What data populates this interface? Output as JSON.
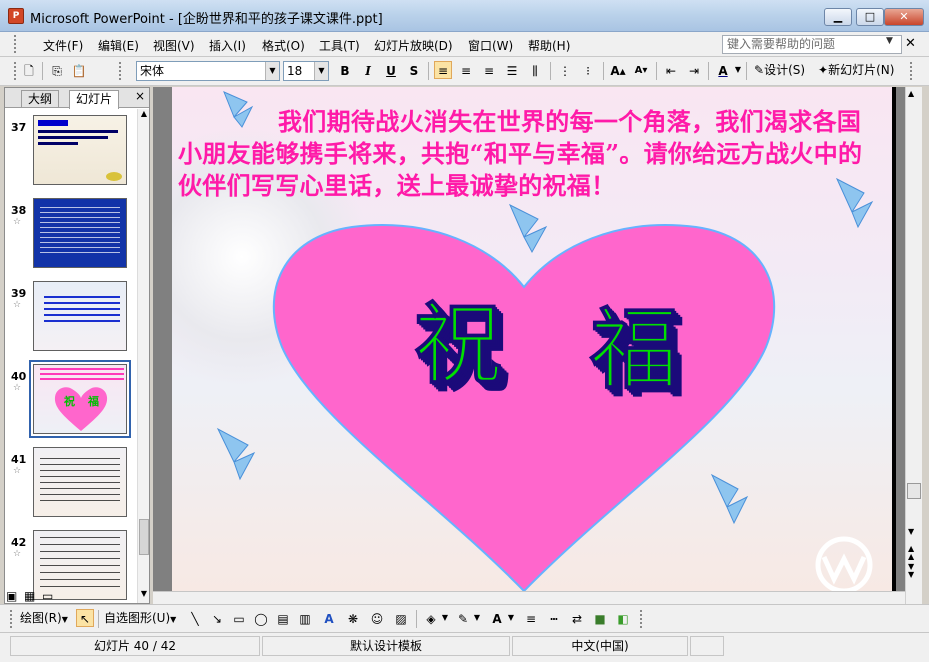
{
  "window": {
    "title": "Microsoft PowerPoint - [企盼世界和平的孩子课文课件.ppt]",
    "app_icon": "P"
  },
  "menu": [
    "文件(F)",
    "编辑(E)",
    "视图(V)",
    "插入(I)",
    "格式(O)",
    "工具(T)",
    "幻灯片放映(D)",
    "窗口(W)",
    "帮助(H)"
  ],
  "help_search": {
    "placeholder": "键入需要帮助的问题"
  },
  "toolbar": {
    "font_name": "宋体",
    "font_size": "18",
    "bold": "B",
    "italic": "I",
    "underline": "U",
    "shadow": "S",
    "design_label": "设计(S)",
    "new_slide_label": "新幻灯片(N)"
  },
  "panel": {
    "tabs": [
      "大纲",
      "幻灯片"
    ],
    "close": "×",
    "thumbs": [
      {
        "num": "37",
        "star": ""
      },
      {
        "num": "38",
        "star": "☆"
      },
      {
        "num": "39",
        "star": "☆"
      },
      {
        "num": "40",
        "star": "☆"
      },
      {
        "num": "41",
        "star": "☆"
      },
      {
        "num": "42",
        "star": "☆"
      }
    ]
  },
  "slide": {
    "text": "我们期待战火消失在世界的每一个角落，我们渴求各国小朋友能够携手将来，共抱“和平与幸福”。请你给远方战火中的伙伴们写写心里话，送上最诚挚的祝福！",
    "char1": "祝",
    "char2": "福",
    "heart_color": "#ff66cc",
    "title_color": "#ff1aa8"
  },
  "drawbar": {
    "draw_label": "绘图(R)",
    "autoshape_label": "自选图形(U)"
  },
  "status": {
    "slide": "幻灯片 40 / 42",
    "template": "默认设计模板",
    "language": "中文(中国)"
  }
}
